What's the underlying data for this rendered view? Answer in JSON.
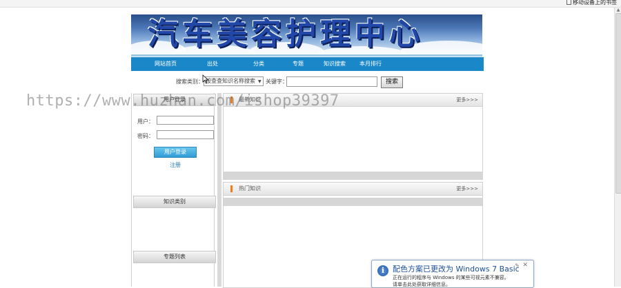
{
  "browser": {
    "bookmark_label": "移动设备上的书签"
  },
  "banner": {
    "title": "汽车美容护理中心",
    "colors": {
      "sky_top": "#2a4f8a",
      "text": "#2148a8"
    }
  },
  "nav": {
    "items": [
      "网站首页",
      "出处",
      "分类",
      "专题",
      "知识搜索",
      "本月排行"
    ],
    "color": "#1a88c8"
  },
  "search": {
    "category_label": "搜索类别：",
    "category_value": "按查查知识名称搜索",
    "keyword_label": "关键字：",
    "keyword_value": "",
    "button_label": "搜索"
  },
  "sidebar": {
    "login_header": "用户登录",
    "user_label": "用户：",
    "password_label": "密码：",
    "user_value": "",
    "password_value": "",
    "login_button": "用户登录",
    "register_link": "注册",
    "category_header": "知识类别",
    "topics_header": "专题列表"
  },
  "panels": [
    {
      "title": "最新知识",
      "more": "更多>>>"
    },
    {
      "title": "热门知识",
      "more": "更多>>>"
    }
  ],
  "watermark": "https://www.huzhan.com/ishop39397",
  "notification": {
    "title": "配色方案已更改为 Windows 7 Basic",
    "body_line1": "正在运行的程序与 Windows 的某些可视元素不兼容。",
    "body_line2": "请单击此处获取详细信息。"
  }
}
